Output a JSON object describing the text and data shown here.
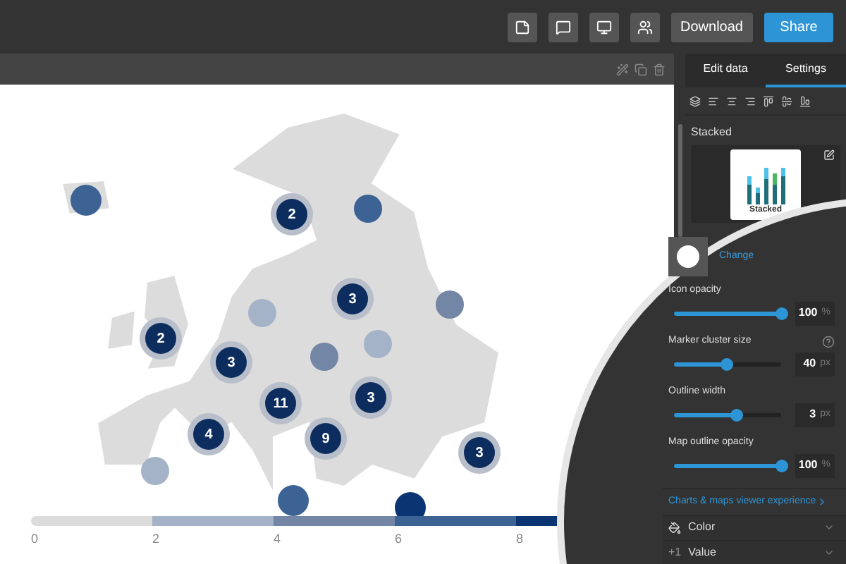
{
  "header": {
    "buttons": [
      {
        "label": "Download",
        "kind": "secondary"
      },
      {
        "label": "Share",
        "kind": "primary"
      }
    ]
  },
  "tabs": [
    {
      "label": "Edit data",
      "selected": false
    },
    {
      "label": "Settings",
      "selected": true
    }
  ],
  "layout": {
    "label": "Stacked",
    "thumbnail_label": "Stacked"
  },
  "icon_swatch": {
    "action": "Change"
  },
  "sliders": [
    {
      "label": "Icon opacity",
      "level": 1,
      "value": "100",
      "unit": "%",
      "help": false
    },
    {
      "label": "Marker cluster size",
      "level": 0.49,
      "value": "40",
      "unit": "px",
      "help": true
    },
    {
      "label": "Outline width",
      "level": 0.58,
      "value": "3",
      "unit": "px",
      "help": false
    },
    {
      "label": "Map outline opacity",
      "level": 1,
      "value": "100",
      "unit": "%",
      "help": false
    }
  ],
  "link": "Charts & maps viewer experience",
  "sections": [
    {
      "kind": "paint",
      "label": "Color"
    },
    {
      "kind": "text",
      "icon_text": "+1",
      "label": "Value"
    }
  ],
  "markers": [
    {
      "color": "#3d6395"
    },
    {
      "label": "2",
      "color": "#0d2d5e"
    },
    {
      "color": "#3d6395"
    },
    {
      "color": "#a4b3c7"
    },
    {
      "label": "3",
      "color": "#0d2d5e"
    },
    {
      "color": "#7486a6"
    },
    {
      "label": "2",
      "color": "#0d2d5e"
    },
    {
      "label": "3",
      "color": "#0d2d5e"
    },
    {
      "color": "#7486a6"
    },
    {
      "color": "#a4b3c7"
    },
    {
      "label": "11",
      "color": "#0d2d5e"
    },
    {
      "label": "3",
      "color": "#0d2d5e"
    },
    {
      "label": "4",
      "color": "#0d2d5e"
    },
    {
      "label": "9",
      "color": "#0d2d5e"
    },
    {
      "color": "#a4b3c7"
    },
    {
      "label": "3",
      "color": "#0d2d5e"
    },
    {
      "color": "#3d6395"
    },
    {
      "color": "#0a3572"
    }
  ],
  "legend": {
    "segments": [
      {
        "color": "#dcdcdc"
      },
      {
        "color": "#a4b3c7"
      },
      {
        "color": "#7486a6"
      },
      {
        "color": "#3d6395"
      },
      {
        "color": "#0a3572"
      }
    ],
    "ticks": [
      "0",
      "2",
      "4",
      "6",
      "8"
    ]
  }
}
